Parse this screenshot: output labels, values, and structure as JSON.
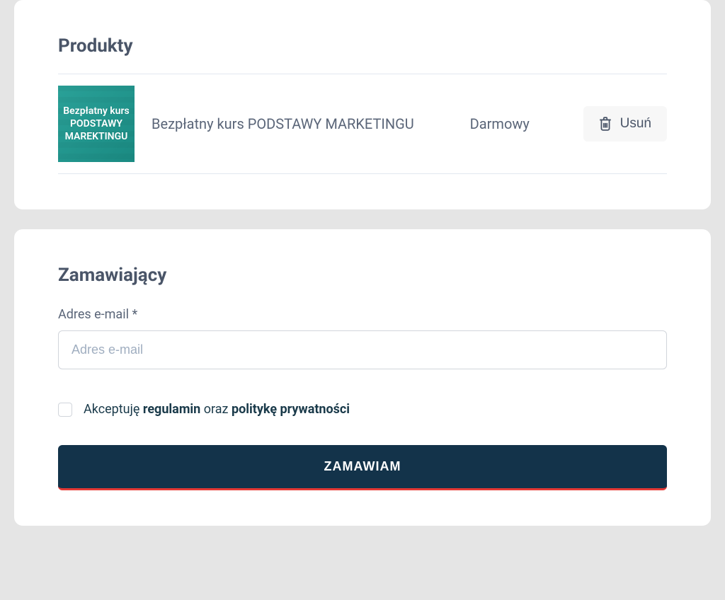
{
  "products": {
    "title": "Produkty",
    "items": [
      {
        "thumb_line1": "Bezpłatny kurs",
        "thumb_line2": "PODSTAWY",
        "thumb_line3": "MAREKTINGU",
        "name": "Bezpłatny kurs PODSTAWY MARKETINGU",
        "price": "Darmowy",
        "remove_label": "Usuń"
      }
    ]
  },
  "customer": {
    "title": "Zamawiający",
    "email_label": "Adres e-mail *",
    "email_placeholder": "Adres e-mail",
    "terms_prefix": "Akceptuję ",
    "terms_regulamin": "regulamin",
    "terms_middle": " oraz ",
    "terms_privacy": "politykę prywatności",
    "submit_label": "ZAMAWIAM"
  }
}
